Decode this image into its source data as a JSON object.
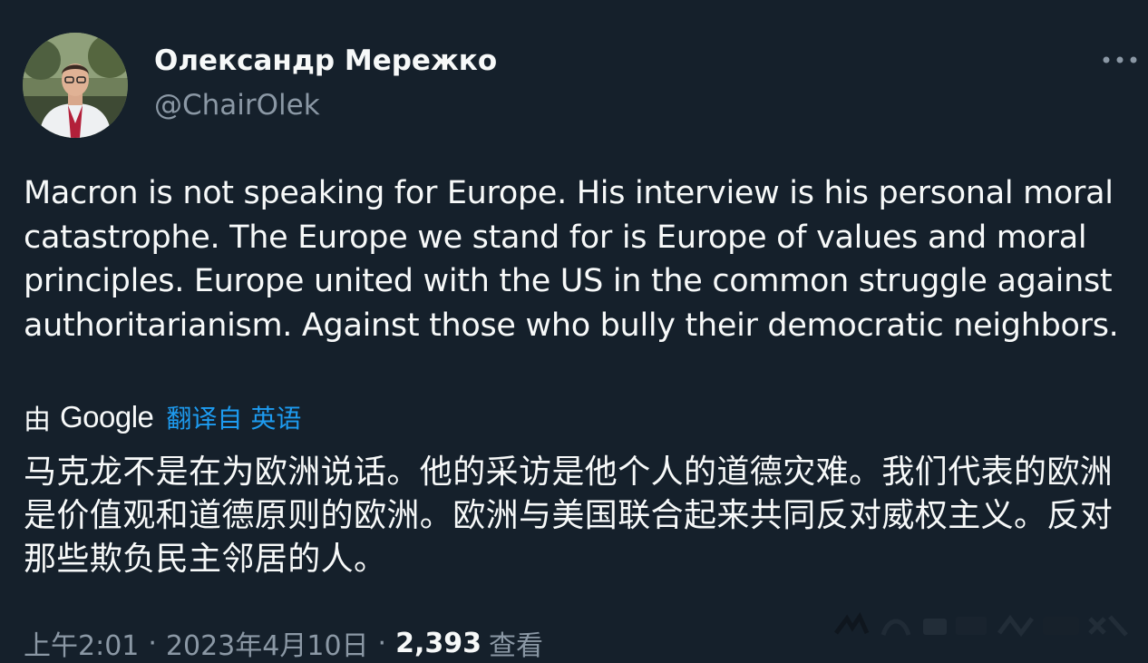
{
  "author": {
    "display_name": "Олександр Мережко",
    "handle": "@ChairOlek"
  },
  "tweet": {
    "text": "Macron is not speaking for Europe. His interview is his personal moral catastrophe. The Europe we stand for is Europe of values and moral principles. Europe united with the US in the common struggle against authoritarianism. Against those who bully their democratic neighbors."
  },
  "translation": {
    "prefix": "由",
    "provider": "Google",
    "link_label": "翻译自 英语",
    "text": "马克龙不是在为欧洲说话。他的采访是他个人的道德灾难。我们代表的欧洲是价值观和道德原则的欧洲。欧洲与美国联合起来共同反对威权主义。反对那些欺负民主邻居的人。"
  },
  "meta": {
    "time": "上午2:01",
    "separator": "·",
    "date": "2023年4月10日",
    "views_count": "2,393",
    "views_label": "查看"
  },
  "icons": {
    "more": "more-horizontal-icon"
  },
  "colors": {
    "background": "#15202b",
    "text_primary": "#f7f9f9",
    "text_secondary": "#8b98a5",
    "link": "#1d9bf0"
  }
}
